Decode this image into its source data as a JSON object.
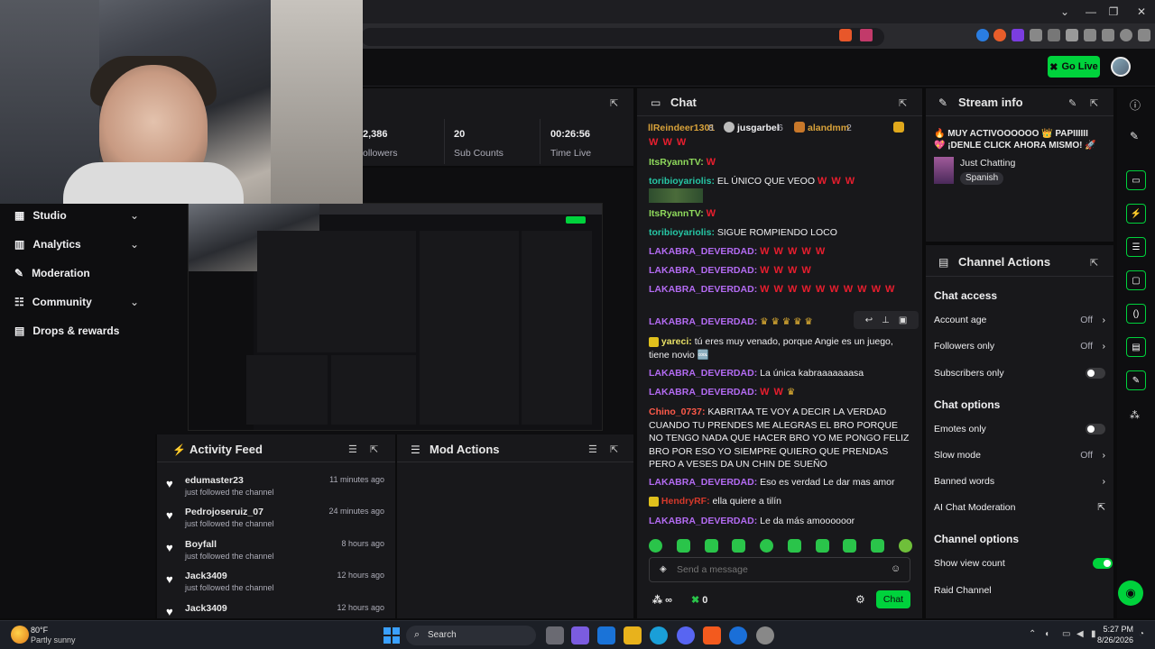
{
  "window": {
    "min": "⌄",
    "minimize": "—",
    "restore": "❐",
    "close": "✕"
  },
  "header": {
    "go_live": "Go Live"
  },
  "sidebar": {
    "items": [
      {
        "label": "Studio",
        "expandable": true,
        "icon": "studio-icon"
      },
      {
        "label": "Analytics",
        "expandable": true,
        "icon": "chart-icon"
      },
      {
        "label": "Moderation",
        "expandable": false,
        "icon": "wrench-icon"
      },
      {
        "label": "Community",
        "expandable": true,
        "icon": "community-icon"
      },
      {
        "label": "Drops & rewards",
        "expandable": false,
        "icon": "gift-icon"
      }
    ]
  },
  "stats": {
    "followers_value": "2,386",
    "followers_label": "ollowers",
    "subs_value": "20",
    "subs_label": "Sub Counts",
    "time_value": "00:26:56",
    "time_label": "Time Live"
  },
  "activity": {
    "title": "Activity Feed",
    "items": [
      {
        "name": "edumaster23",
        "sub": "just followed the channel",
        "time": "11 minutes ago"
      },
      {
        "name": "Pedrojoseruiz_07",
        "sub": "just followed the channel",
        "time": "24 minutes ago"
      },
      {
        "name": "Boyfall",
        "sub": "just followed the channel",
        "time": "8 hours ago"
      },
      {
        "name": "Jack3409",
        "sub": "just followed the channel",
        "time": "12 hours ago"
      },
      {
        "name": "Jack3409",
        "sub": "",
        "time": "12 hours ago"
      }
    ]
  },
  "mod_actions": {
    "title": "Mod Actions"
  },
  "chat": {
    "title": "Chat",
    "leaderboard": [
      {
        "name": "llReindeer1301",
        "rank": "8"
      },
      {
        "name": "jusgarbel",
        "rank": "6"
      },
      {
        "name": "alandmm",
        "rank": "2"
      }
    ],
    "messages": [
      {
        "user": "",
        "text": "",
        "w": "W W W",
        "color": "#efeff1"
      },
      {
        "user": "ItsRyannTV",
        "text": "",
        "w": "W",
        "color": "#8fd95c"
      },
      {
        "user": "toribioyariolis",
        "text": "EL ÚNICO QUE VEOO",
        "w": "W W W",
        "color": "#26c6a5"
      },
      {
        "user": "ItsRyannTV",
        "text": "",
        "w": "W",
        "color": "#8fd95c"
      },
      {
        "user": "toribioyariolis",
        "text": "SIGUE ROMPIENDO LOCO",
        "w": "",
        "color": "#26c6a5"
      },
      {
        "user": "LAKABRA_DEVERDAD",
        "text": "",
        "w": "W W W W W",
        "color": "#b36bf2"
      },
      {
        "user": "LAKABRA_DEVERDAD",
        "text": "",
        "w": "W W W W",
        "color": "#b36bf2"
      },
      {
        "user": "LAKABRA_DEVERDAD",
        "text": "",
        "w": "W W W W W W W W W W",
        "color": "#b36bf2"
      },
      {
        "user": "LAKABRA_DEVERDAD",
        "text": "♛ ♛ ♛ ♛ ♛",
        "w": "",
        "color": "#b36bf2"
      },
      {
        "user": "yareci",
        "text": "tú eres muy venado, porque Angie es un juego, tiene novio 🆒",
        "w": "",
        "color": "#e8e066"
      },
      {
        "user": "LAKABRA_DEVERDAD",
        "text": "La única kabraaaaaaasa",
        "w": "",
        "color": "#b36bf2"
      },
      {
        "user": "LAKABRA_DEVERDAD",
        "text": "♛",
        "w": "W W",
        "color": "#b36bf2"
      },
      {
        "user": "Chino_0737",
        "text": "KABRITAA TE VOY A DECIR LA VERDAD CUANDO TU PRENDES ME ALEGRAS EL BRO PORQUE NO TENGO NADA QUE HACER BRO YO ME PONGO FELIZ BRO POR ESO YO SIEMPRE QUIERO QUE PRENDAS PERO A VESES DA UN CHIN DE SUEÑO",
        "w": "",
        "color": "#ff5a4a"
      },
      {
        "user": "LAKABRA_DEVERDAD",
        "text": "Eso es verdad Le dar mas amor",
        "w": "",
        "color": "#b36bf2"
      },
      {
        "user": "HendryRF",
        "text": "ella quiere a tilín",
        "w": "",
        "color": "#d6392b"
      },
      {
        "user": "LAKABRA_DEVERDAD",
        "text": "Le da más amoooooor",
        "w": "",
        "color": "#b36bf2"
      }
    ],
    "input_placeholder": "Send a message",
    "points": "∞",
    "count": "0",
    "send_label": "Chat"
  },
  "stream_info": {
    "title": "Stream info",
    "stream_title": "🔥 MUY ACTIVOOOOOO 👑 PAPIIIIII 💖 ¡DENLE CLICK AHORA MISMO! 🚀 ...",
    "category": "Just Chatting",
    "tag": "Spanish"
  },
  "channel_actions": {
    "title": "Channel Actions",
    "chat_access": "Chat access",
    "account_age": "Account age",
    "account_age_value": "Off",
    "followers_only": "Followers only",
    "followers_only_value": "Off",
    "subscribers_only": "Subscribers only",
    "chat_options": "Chat options",
    "emotes_only": "Emotes only",
    "slow_mode": "Slow mode",
    "slow_mode_value": "Off",
    "banned_words": "Banned words",
    "ai_moderation": "AI Chat Moderation",
    "channel_options": "Channel options",
    "show_view_count": "Show view count",
    "raid_channel": "Raid Channel"
  },
  "taskbar": {
    "weather_temp": "80°F",
    "weather_desc": "Partly sunny",
    "search": "Search",
    "time": "5:27 PM",
    "date": "8/26/2026"
  },
  "colors": {
    "accent": "#00d23c",
    "panel": "#18181b",
    "bg": "#0e0e10",
    "w_emote": "#e81e2e"
  }
}
